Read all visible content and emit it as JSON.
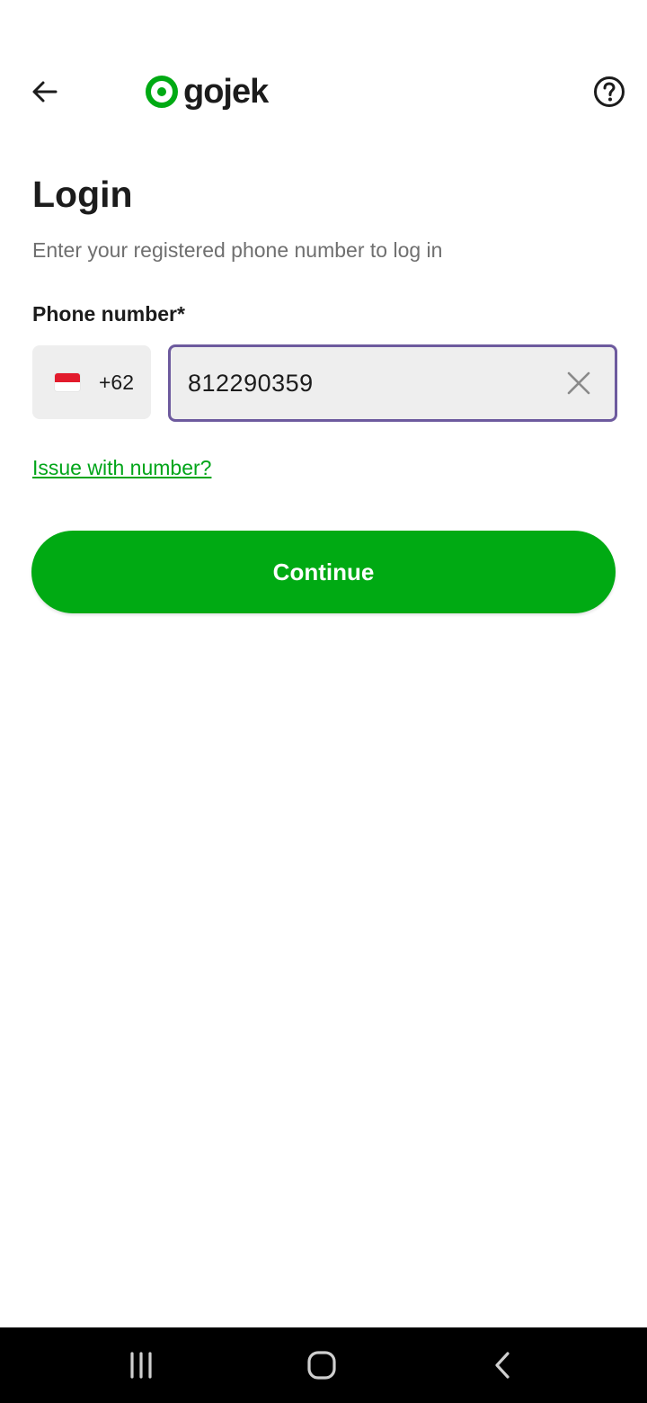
{
  "header": {
    "back_icon": "arrow-left-icon",
    "logo_text": "gojek",
    "help_icon": "question-circle-icon"
  },
  "login": {
    "title": "Login",
    "subtitle": "Enter your registered phone number to log in",
    "phone_label": "Phone number*",
    "country_code": "+62",
    "country_flag": "indonesia-flag-icon",
    "phone_value": "812290359",
    "issue_link": "Issue with number?",
    "continue_label": "Continue"
  },
  "colors": {
    "brand_green": "#00aa13",
    "link_green": "#00a519",
    "focus_border": "#6d5a9e"
  },
  "system_nav": {
    "recents_icon": "recent-apps-icon",
    "home_icon": "home-icon",
    "back_icon": "back-chevron-icon"
  }
}
